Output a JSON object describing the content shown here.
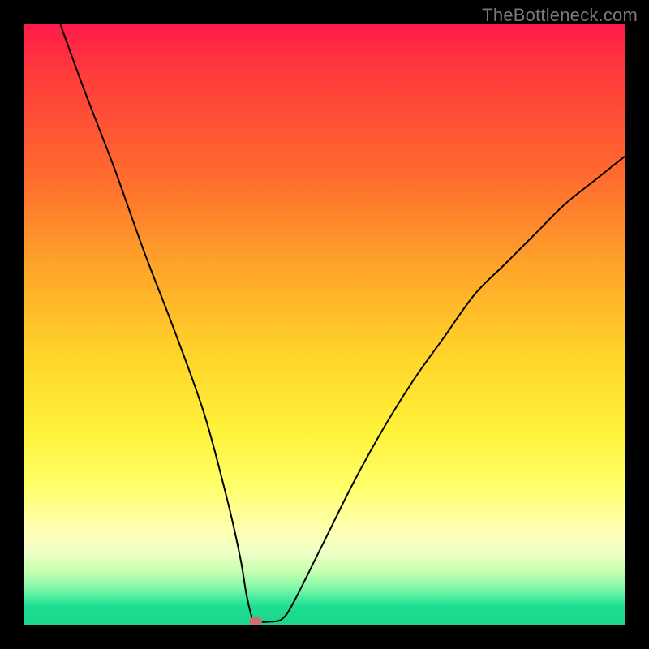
{
  "watermark": "TheBottleneck.com",
  "chart_data": {
    "type": "line",
    "title": "",
    "xlabel": "",
    "ylabel": "",
    "xlim": [
      0,
      100
    ],
    "ylim": [
      0,
      100
    ],
    "grid": false,
    "legend": false,
    "series": [
      {
        "name": "bottleneck-curve",
        "x": [
          6,
          10,
          15,
          20,
          25,
          30,
          34,
          36,
          37,
          38,
          39,
          41,
          43,
          45,
          50,
          55,
          60,
          65,
          70,
          75,
          80,
          85,
          90,
          95,
          100
        ],
        "y": [
          100,
          89,
          76,
          62,
          49,
          35,
          20,
          11,
          5,
          1,
          0.5,
          0.5,
          1,
          4,
          14,
          24,
          33,
          41,
          48,
          55,
          60,
          65,
          70,
          74,
          78
        ]
      }
    ],
    "annotations": [
      {
        "name": "optimal-point",
        "x": 38.5,
        "y": 0.5
      }
    ],
    "background_gradient": {
      "top": "#ff1a4a",
      "bottom": "#19d88c",
      "meaning": "red=high bottleneck, green=no bottleneck"
    }
  }
}
